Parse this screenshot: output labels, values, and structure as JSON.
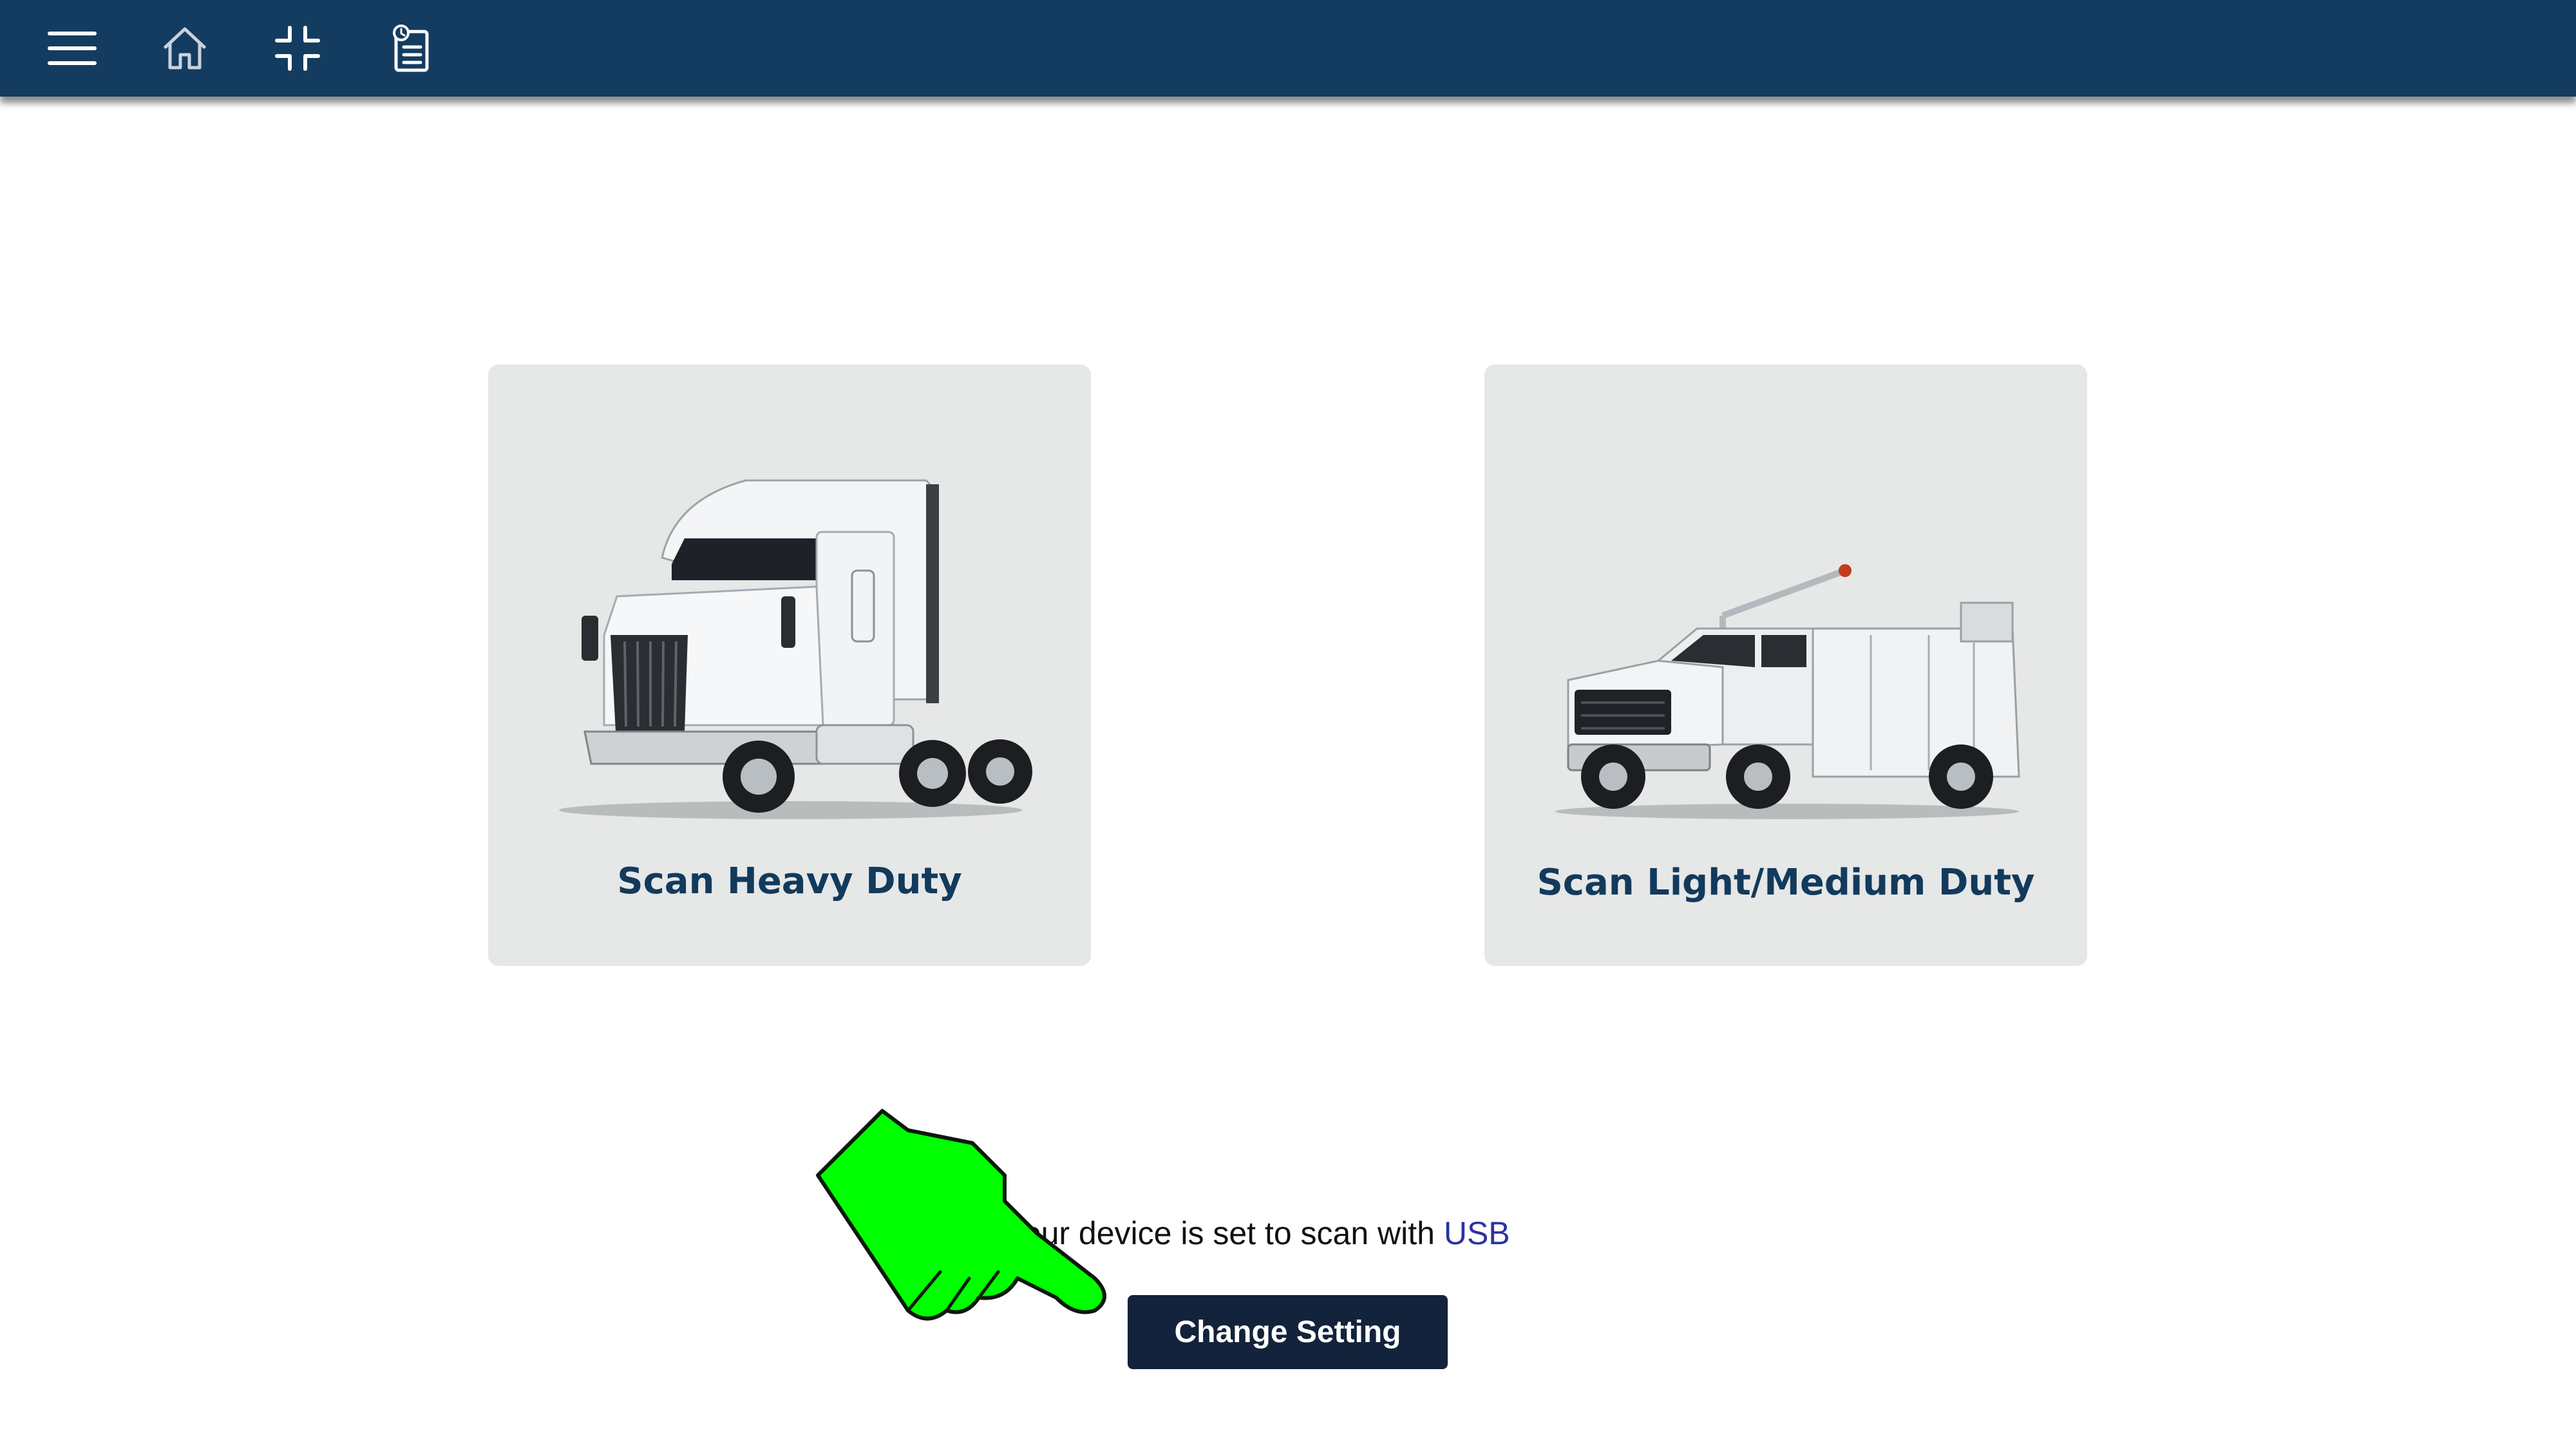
{
  "toolbar": {
    "icons": [
      "menu-icon",
      "home-icon",
      "collapse-icon",
      "report-icon"
    ]
  },
  "cards": [
    {
      "label": "Scan Heavy Duty",
      "image": "semi-truck"
    },
    {
      "label": "Scan Light/Medium Duty",
      "image": "service-pickup-truck"
    }
  ],
  "status": {
    "prefix": "Your device is set to scan with ",
    "mode": "USB"
  },
  "actions": {
    "change_setting_label": "Change Setting"
  },
  "colors": {
    "toolbar": "#143c60",
    "card_background": "#e6e7e7",
    "card_label": "#123a5c",
    "button": "#13233b",
    "mode_link": "#2b33a0",
    "pointer_hand": "#00ff00"
  }
}
